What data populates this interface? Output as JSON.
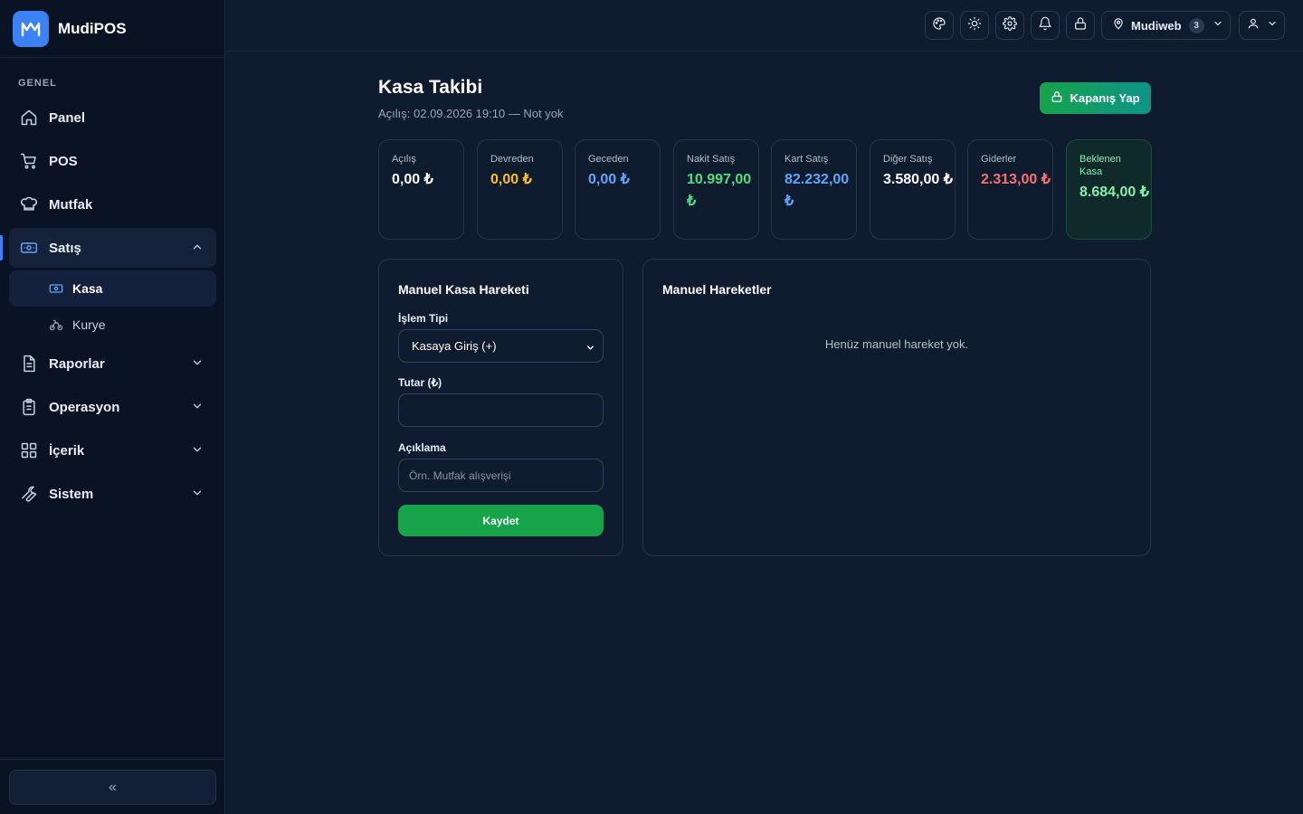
{
  "brand": {
    "name": "MudiPOS",
    "logo_text": "M"
  },
  "sidebar": {
    "section_label": "GENEL",
    "items": [
      {
        "label": "Panel",
        "icon": "home-icon"
      },
      {
        "label": "POS",
        "icon": "cart-icon"
      },
      {
        "label": "Mutfak",
        "icon": "chef-hat-icon"
      },
      {
        "label": "Satış",
        "icon": "banknote-icon",
        "expanded": true
      },
      {
        "label": "Raporlar",
        "icon": "file-icon"
      },
      {
        "label": "Operasyon",
        "icon": "clipboard-icon"
      },
      {
        "label": "İçerik",
        "icon": "grid-icon"
      },
      {
        "label": "Sistem",
        "icon": "wrench-icon"
      }
    ],
    "sub_items": [
      {
        "label": "Kasa",
        "icon": "banknote-icon",
        "active": true
      },
      {
        "label": "Kurye",
        "icon": "bicycle-icon"
      }
    ],
    "collapse_label": "«"
  },
  "topbar": {
    "branch_name": "Mudiweb",
    "branch_count": "3"
  },
  "page": {
    "title": "Kasa Takibi",
    "subtitle": "Açılış: 02.09.2026 19:10 — Not yok",
    "close_button": "Kapanış Yap"
  },
  "stats": [
    {
      "label": "Açılış",
      "value": "0,00 ₺",
      "color": "#ffffff"
    },
    {
      "label": "Devreden",
      "value": "0,00 ₺",
      "color": "#fbbf24"
    },
    {
      "label": "Geceden",
      "value": "0,00 ₺",
      "color": "#60a5fa"
    },
    {
      "label": "Nakit Satış",
      "value": "10.997,00 ₺",
      "color": "#4ade80"
    },
    {
      "label": "Kart Satış",
      "value": "82.232,00 ₺",
      "color": "#60a5fa"
    },
    {
      "label": "Diğer Satış",
      "value": "3.580,00 ₺",
      "color": "#ffffff"
    },
    {
      "label": "Giderler",
      "value": "2.313,00 ₺",
      "color": "#f87171"
    },
    {
      "label": "Beklenen Kasa",
      "value": "8.684,00 ₺",
      "color": "#86efac"
    }
  ],
  "manual_form": {
    "title": "Manuel Kasa Hareketi",
    "type_label": "İşlem Tipi",
    "type_value": "Kasaya Giriş (+)",
    "amount_label": "Tutar (₺)",
    "amount_value": "",
    "desc_label": "Açıklama",
    "desc_placeholder": "Örn. Mutfak alışverişi",
    "save_button": "Kaydet"
  },
  "manual_list": {
    "title": "Manuel Hareketler",
    "empty_text": "Henüz manuel hareket yok."
  }
}
